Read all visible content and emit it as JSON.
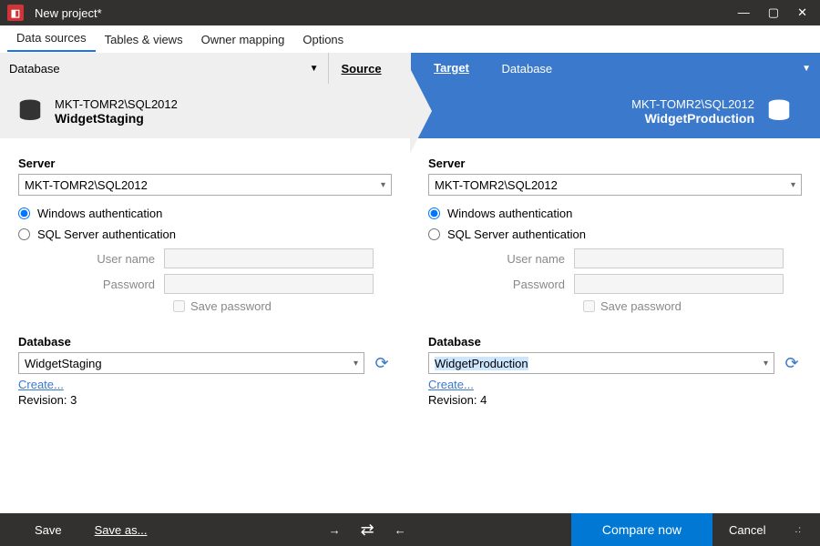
{
  "window": {
    "title": "New project*"
  },
  "menu": {
    "items": [
      "Data sources",
      "Tables & views",
      "Owner mapping",
      "Options"
    ],
    "active": 0
  },
  "header": {
    "source_dd": "Database",
    "source_label": "Source",
    "target_label": "Target",
    "target_dd": "Database"
  },
  "banner": {
    "source": {
      "server": "MKT-TOMR2\\SQL2012",
      "db": "WidgetStaging"
    },
    "target": {
      "server": "MKT-TOMR2\\SQL2012",
      "db": "WidgetProduction"
    }
  },
  "labels": {
    "server": "Server",
    "winauth": "Windows authentication",
    "sqlauth": "SQL Server authentication",
    "username": "User name",
    "password": "Password",
    "savepw": "Save password",
    "database": "Database",
    "create": "Create...",
    "save": "Save",
    "saveas": "Save as...",
    "compare": "Compare now",
    "cancel": "Cancel"
  },
  "source": {
    "server": "MKT-TOMR2\\SQL2012",
    "winauth": true,
    "database": "WidgetStaging",
    "revision": "Revision: 3"
  },
  "target": {
    "server": "MKT-TOMR2\\SQL2012",
    "winauth": true,
    "database": "WidgetProduction",
    "revision": "Revision: 4"
  }
}
